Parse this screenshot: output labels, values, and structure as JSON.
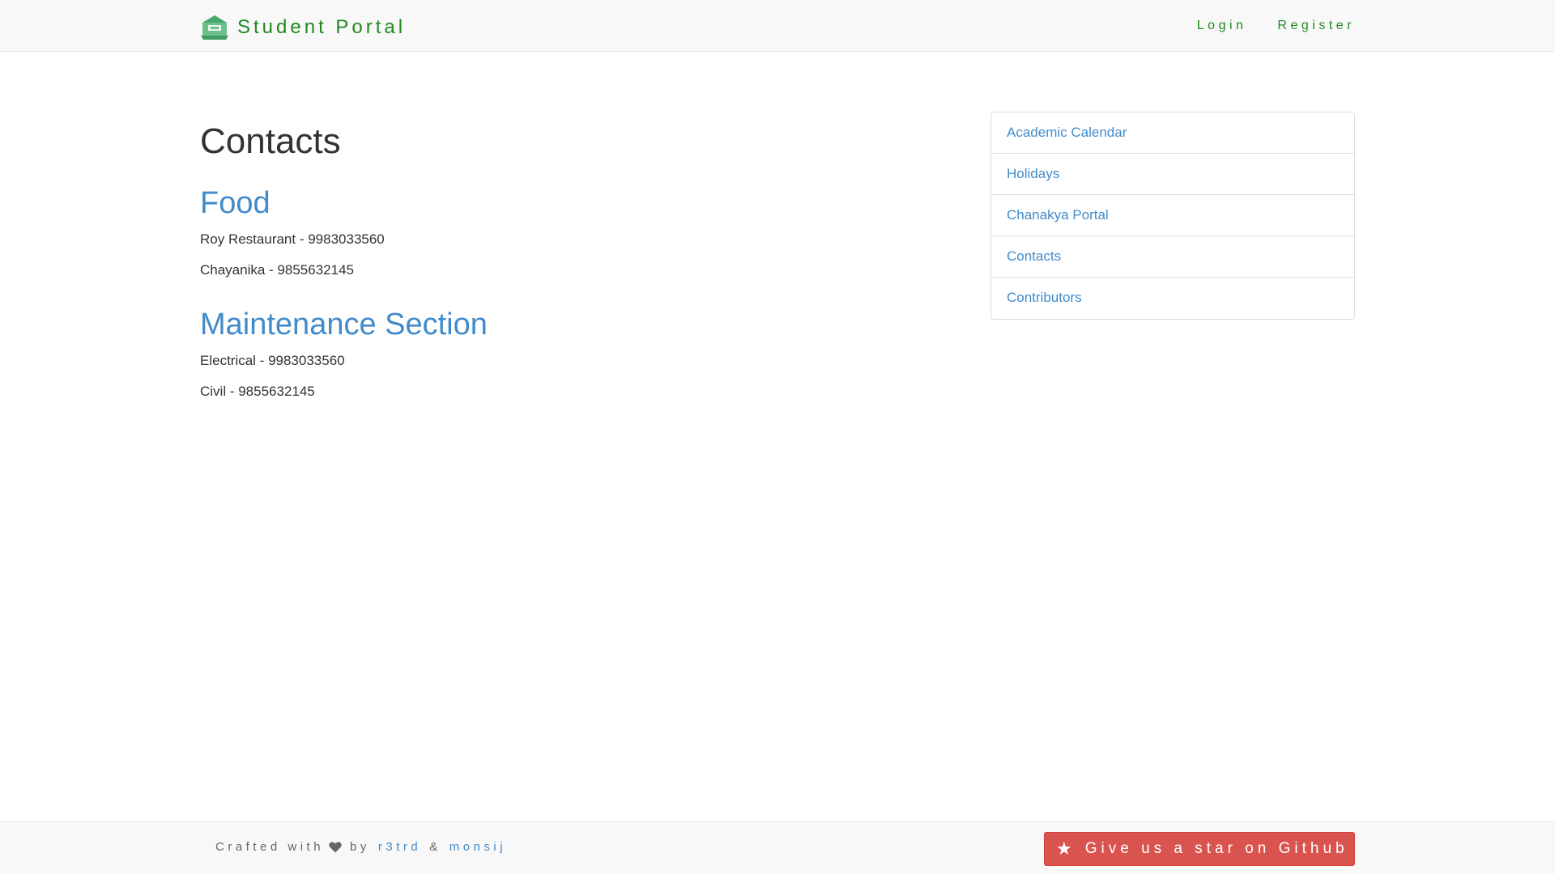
{
  "navbar": {
    "brand_icon": "graduation-building-icon",
    "brand": "Student Portal",
    "links": [
      "Login",
      "Register"
    ]
  },
  "main": {
    "title": "Contacts",
    "sections": [
      {
        "title": "Food",
        "items": [
          "Roy Restaurant - 9983033560",
          "Chayanika - 9855632145"
        ]
      },
      {
        "title": "Maintenance Section",
        "items": [
          "Electrical - 9983033560",
          "Civil - 9855632145"
        ]
      }
    ]
  },
  "sidebar": {
    "items": [
      "Academic Calendar",
      "Holidays",
      "Chanakya Portal",
      "Contacts",
      "Contributors"
    ]
  },
  "footer": {
    "crafted": "Crafted with",
    "heart_icon": "heart-icon",
    "by": "by",
    "author1": "r3trd",
    "amp": "&",
    "author2": "monsij",
    "star_icon": "star-icon",
    "star_label": "Give us a star on Github"
  },
  "colors": {
    "brand_green": "#1f8a1f",
    "link_blue": "#428bca",
    "button_red": "#d9534f",
    "navbar_bg": "#f8f8f8"
  }
}
